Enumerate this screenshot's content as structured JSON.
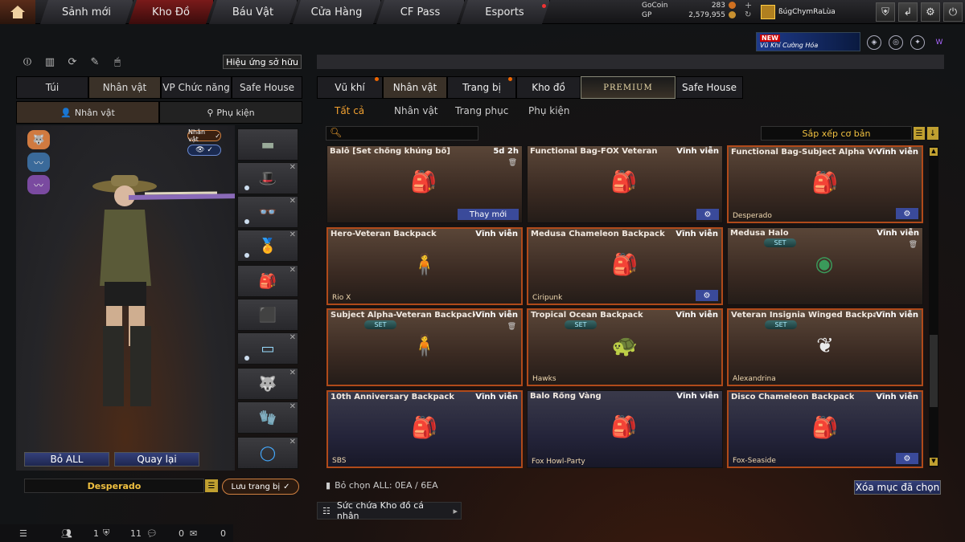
{
  "nav": {
    "tabs": [
      {
        "label": "Sảnh mới"
      },
      {
        "label": "Kho Đồ"
      },
      {
        "label": "Báu Vật"
      },
      {
        "label": "Cửa Hàng"
      },
      {
        "label": "CF Pass"
      },
      {
        "label": "Esports"
      }
    ]
  },
  "currency": {
    "gocoin_label": "GoCoin",
    "gocoin_value": "283",
    "gp_label": "GP",
    "gp_value": "2,579,955"
  },
  "player": {
    "name": "ßúgChymRaLùa"
  },
  "promo": {
    "badge": "NEW",
    "text": "Vũ Khí Cường Hóa"
  },
  "left": {
    "effect_label": "Hiệu ứng sở hữu",
    "tabs": [
      {
        "label": "Túi"
      },
      {
        "label": "Nhân vật"
      },
      {
        "label": "VP Chức năng"
      },
      {
        "label": "Safe House"
      }
    ],
    "subtabs": [
      {
        "label": "Nhân vật"
      },
      {
        "label": "Phụ kiện"
      }
    ],
    "char_badge": "Nhân vật",
    "buttons": {
      "remove_all": "Bỏ ALL",
      "back": "Quay lại"
    },
    "preset_name": "Desperado",
    "save_label": "Lưu trang bị"
  },
  "right": {
    "tabs": [
      {
        "label": "Vũ khí"
      },
      {
        "label": "Nhân vật"
      },
      {
        "label": "Trang bị"
      },
      {
        "label": "Kho đồ"
      },
      {
        "label": "PREMIUM"
      },
      {
        "label": "Safe House"
      }
    ],
    "subtabs": [
      {
        "label": "Tất cả"
      },
      {
        "label": "Nhân vật"
      },
      {
        "label": "Trang phục"
      },
      {
        "label": "Phụ kiện"
      }
    ],
    "sort_label": "Sắp xếp cơ bản",
    "items": [
      {
        "name": "Balô [Set chống khủng bố]",
        "duration": "5d 2h",
        "owner": "",
        "action": "Thay mới",
        "set": ""
      },
      {
        "name": "Functional Bag-FOX Veteran",
        "duration": "Vĩnh viễn",
        "owner": "",
        "action": "",
        "set": ""
      },
      {
        "name": "Functional Bag-Subject Alpha Veteran",
        "duration": "Vĩnh viễn",
        "owner": "Desperado",
        "action": "",
        "set": ""
      },
      {
        "name": "Hero-Veteran Backpack",
        "duration": "Vĩnh viễn",
        "owner": "Rio X",
        "action": "",
        "set": ""
      },
      {
        "name": "Medusa Chameleon Backpack",
        "duration": "Vĩnh viễn",
        "owner": "Ciripunk",
        "action": "",
        "set": ""
      },
      {
        "name": "Medusa Halo",
        "duration": "Vĩnh viễn",
        "owner": "",
        "action": "",
        "set": "SET"
      },
      {
        "name": "Subject Alpha-Veteran Backpack",
        "duration": "Vĩnh viễn",
        "owner": "",
        "action": "",
        "set": "SET"
      },
      {
        "name": "Tropical Ocean Backpack",
        "duration": "Vĩnh viễn",
        "owner": "Hawks",
        "action": "",
        "set": "SET"
      },
      {
        "name": "Veteran Insignia Winged Backpack",
        "duration": "Vĩnh viễn",
        "owner": "Alexandrina",
        "action": "",
        "set": "SET"
      },
      {
        "name": "10th Anniversary Backpack",
        "duration": "Vĩnh viễn",
        "owner": "SBS",
        "action": "",
        "set": ""
      },
      {
        "name": "Balo Rồng Vàng",
        "duration": "Vĩnh viễn",
        "owner": "Fox Howl-Party",
        "action": "",
        "set": ""
      },
      {
        "name": "Disco Chameleon Backpack",
        "duration": "Vĩnh viễn",
        "owner": "Fox-Seaside",
        "action": "",
        "set": ""
      }
    ],
    "footer_text": "Bỏ chọn ALL: 0EA / 6EA",
    "clear_label": "Xóa mục đã chọn",
    "capacity_label": "Sức chứa Kho đồ cá nhân"
  },
  "status": {
    "count1": "1",
    "count2": "11",
    "count3": "0",
    "count4": "0"
  }
}
